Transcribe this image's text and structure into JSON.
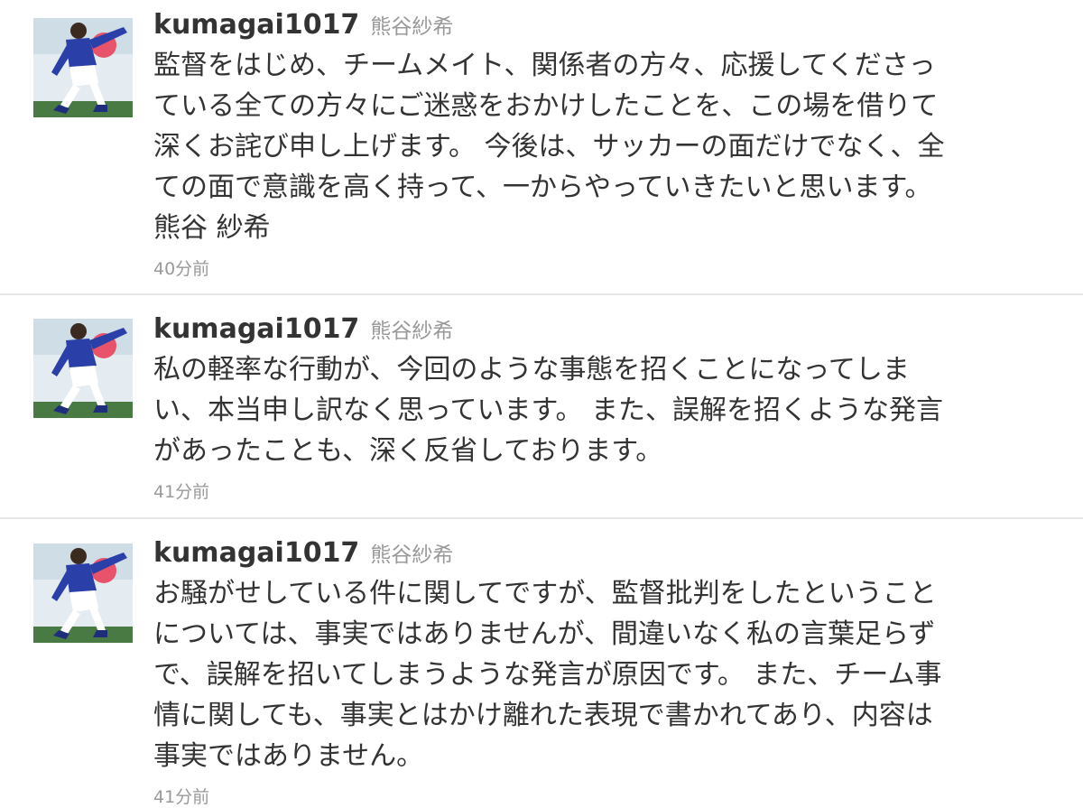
{
  "colors": {
    "screen_name": "#333333",
    "full_name": "#999999",
    "text": "#333333",
    "timestamp": "#999999",
    "divider": "#e6e6e6",
    "avatar_jersey": "#2a3fa8"
  },
  "tweets": [
    {
      "screen_name": "kumagai1017",
      "full_name": "熊谷紗希",
      "avatar_icon": "profile-photo-soccer-player",
      "lines": [
        "監督をはじめ、チームメイト、関係者の方々、応援してくださっ",
        "ている全ての方々にご迷惑をおかけしたことを、この場を借りて",
        "深くお詫び申し上げます。 今後は、サッカーの面だけでなく、全",
        "ての面で意識を高く持って、一からやっていきたいと思います。",
        "熊谷 紗希"
      ],
      "timestamp": "40分前"
    },
    {
      "screen_name": "kumagai1017",
      "full_name": "熊谷紗希",
      "avatar_icon": "profile-photo-soccer-player",
      "lines": [
        "私の軽率な行動が、今回のような事態を招くことになってしま",
        "い、本当申し訳なく思っています。 また、誤解を招くような発言",
        "があったことも、深く反省しております。"
      ],
      "timestamp": "41分前"
    },
    {
      "screen_name": "kumagai1017",
      "full_name": "熊谷紗希",
      "avatar_icon": "profile-photo-soccer-player",
      "lines": [
        "お騒がせしている件に関してですが、監督批判をしたということ",
        "については、事実ではありませんが、間違いなく私の言葉足らず",
        "で、誤解を招いてしまうような発言が原因です。 また、チーム事",
        "情に関しても、事実とはかけ離れた表現で書かれてあり、内容は",
        "事実ではありません。"
      ],
      "timestamp": "41分前"
    }
  ]
}
